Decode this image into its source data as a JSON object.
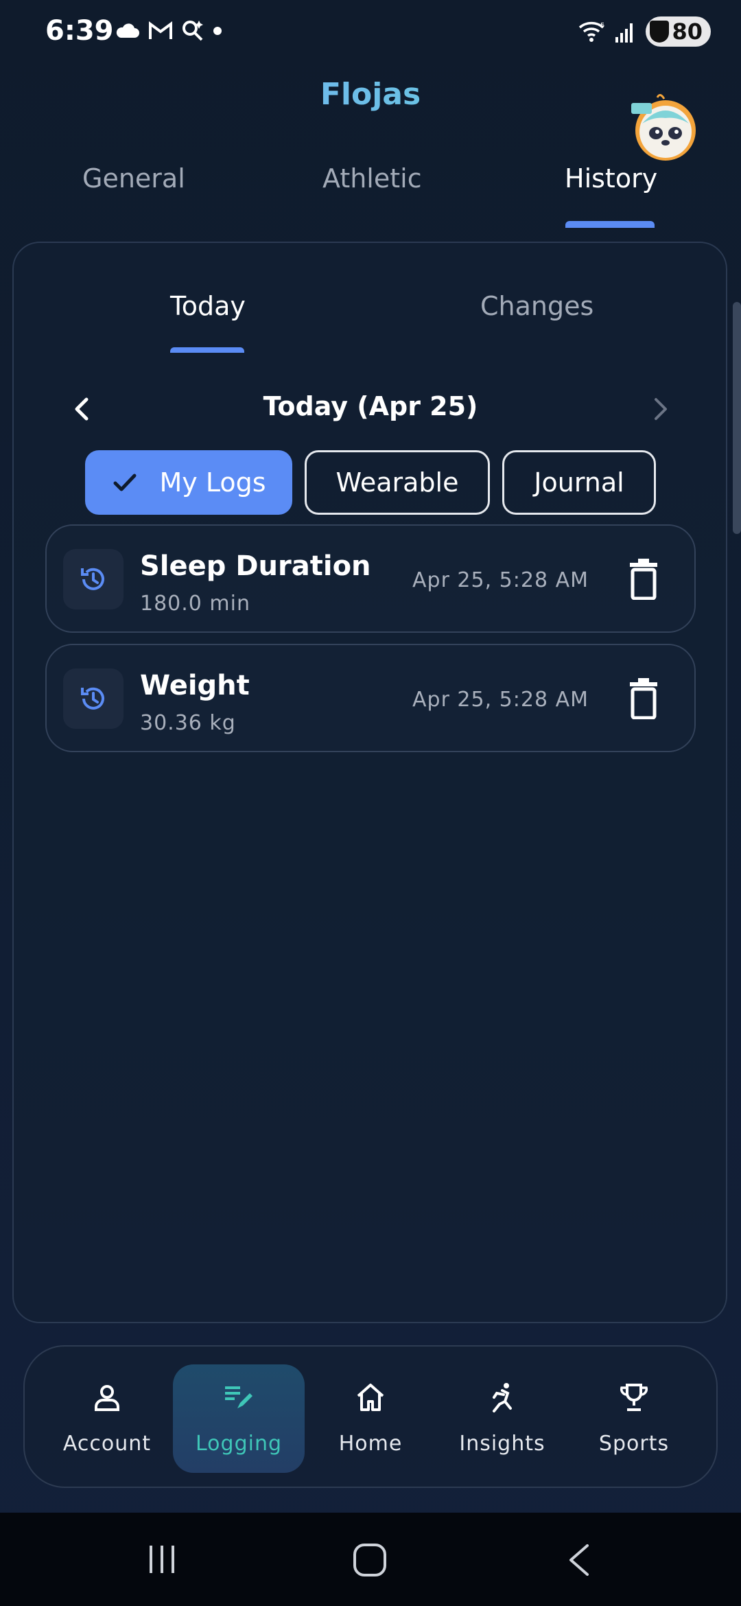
{
  "status_bar": {
    "time": "6:39",
    "battery": "80"
  },
  "header": {
    "app_title": "Flojas",
    "mascot_icon": "sloth-mascot-icon"
  },
  "top_tabs": [
    {
      "label": "General",
      "active": false
    },
    {
      "label": "Athletic",
      "active": false
    },
    {
      "label": "History",
      "active": true
    }
  ],
  "sub_tabs": [
    {
      "label": "Today",
      "active": true
    },
    {
      "label": "Changes",
      "active": false
    }
  ],
  "date_nav": {
    "label": "Today (Apr 25)"
  },
  "filters": [
    {
      "label": "My Logs",
      "selected": true
    },
    {
      "label": "Wearable",
      "selected": false
    },
    {
      "label": "Journal",
      "selected": false
    }
  ],
  "logs": [
    {
      "title": "Sleep Duration",
      "value": "180.0 min",
      "time": "Apr 25, 5:28 AM",
      "icon": "history-icon"
    },
    {
      "title": "Weight",
      "value": "30.36 kg",
      "time": "Apr 25, 5:28 AM",
      "icon": "history-icon"
    }
  ],
  "bottom_nav": [
    {
      "label": "Account",
      "icon": "person-icon",
      "active": false
    },
    {
      "label": "Logging",
      "icon": "edit-list-icon",
      "active": true
    },
    {
      "label": "Home",
      "icon": "home-icon",
      "active": false
    },
    {
      "label": "Insights",
      "icon": "runner-icon",
      "active": false
    },
    {
      "label": "Sports",
      "icon": "trophy-icon",
      "active": false
    }
  ],
  "colors": {
    "accent": "#5b8cf5",
    "active_nav_text": "#3fc7b8",
    "background": "#101d31"
  }
}
